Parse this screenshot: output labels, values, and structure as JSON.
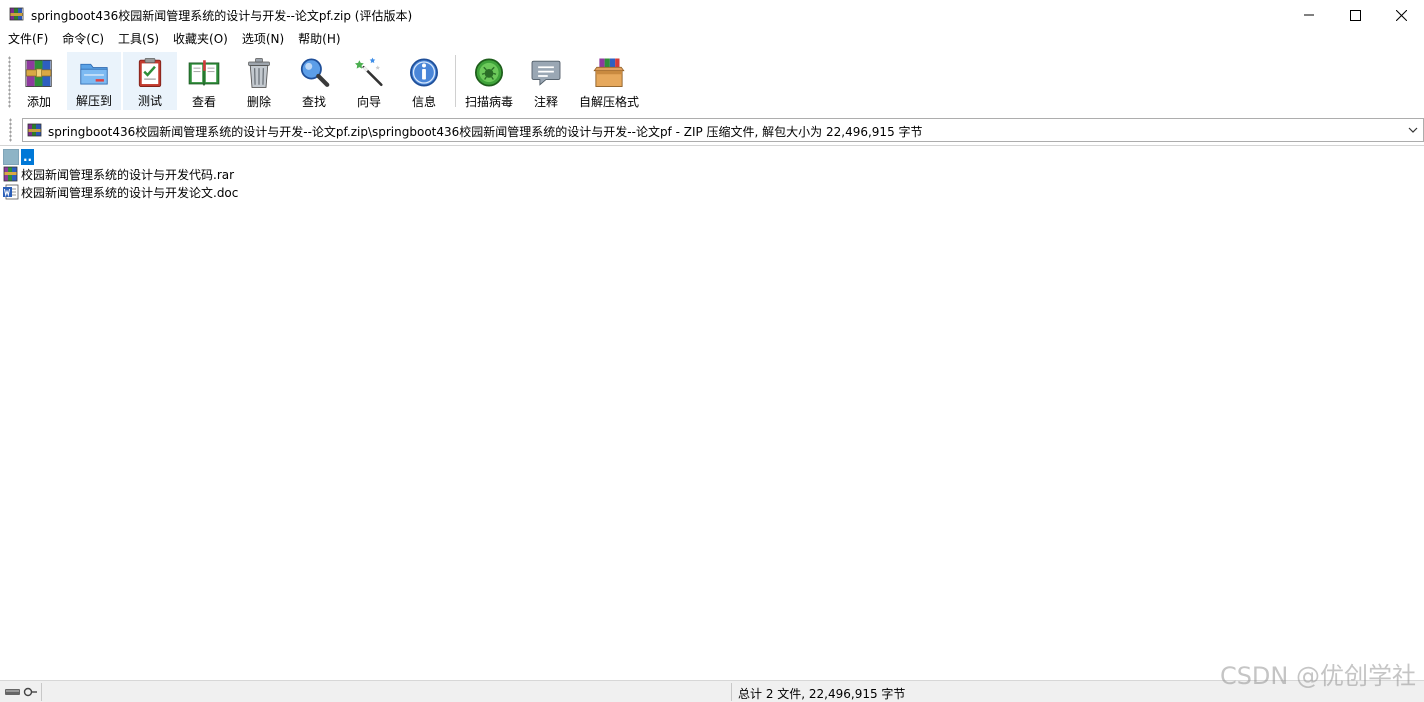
{
  "window": {
    "title": "springboot436校园新闻管理系统的设计与开发--论文pf.zip (评估版本)",
    "minimize_icon": "minimize-icon",
    "maximize_icon": "maximize-icon",
    "close_icon": "close-icon"
  },
  "menu": [
    "文件(F)",
    "命令(C)",
    "工具(S)",
    "收藏夹(O)",
    "选项(N)",
    "帮助(H)"
  ],
  "toolbar": {
    "buttons": [
      {
        "label": "添加",
        "icon": "books-add-icon"
      },
      {
        "label": "解压到",
        "icon": "folder-extract-icon"
      },
      {
        "label": "测试",
        "icon": "clipboard-check-icon"
      },
      {
        "label": "查看",
        "icon": "open-book-icon"
      },
      {
        "label": "删除",
        "icon": "trash-icon"
      },
      {
        "label": "查找",
        "icon": "magnifier-icon"
      },
      {
        "label": "向导",
        "icon": "magic-wand-icon"
      },
      {
        "label": "信息",
        "icon": "info-icon"
      },
      {
        "label": "扫描病毒",
        "icon": "virus-scan-icon"
      },
      {
        "label": "注释",
        "icon": "comment-icon"
      },
      {
        "label": "自解压格式",
        "icon": "sfx-box-icon"
      }
    ]
  },
  "address": {
    "path": "springboot436校园新闻管理系统的设计与开发--论文pf.zip\\springboot436校园新闻管理系统的设计与开发--论文pf - ZIP 压缩文件, 解包大小为 22,496,915 字节"
  },
  "files": [
    {
      "name": "..",
      "icon": "folder-up-icon"
    },
    {
      "name": "校园新闻管理系统的设计与开发代码.rar",
      "icon": "rar-file-icon"
    },
    {
      "name": "校园新闻管理系统的设计与开发论文.doc",
      "icon": "word-doc-icon"
    }
  ],
  "status": {
    "summary": "总计 2 文件, 22,496,915 字节",
    "watermark": "CSDN @优创学社"
  },
  "colors": {
    "selection": "#0078d7",
    "status_bg": "#f0f0f0",
    "toolbar_active": "#eaf3fb"
  }
}
